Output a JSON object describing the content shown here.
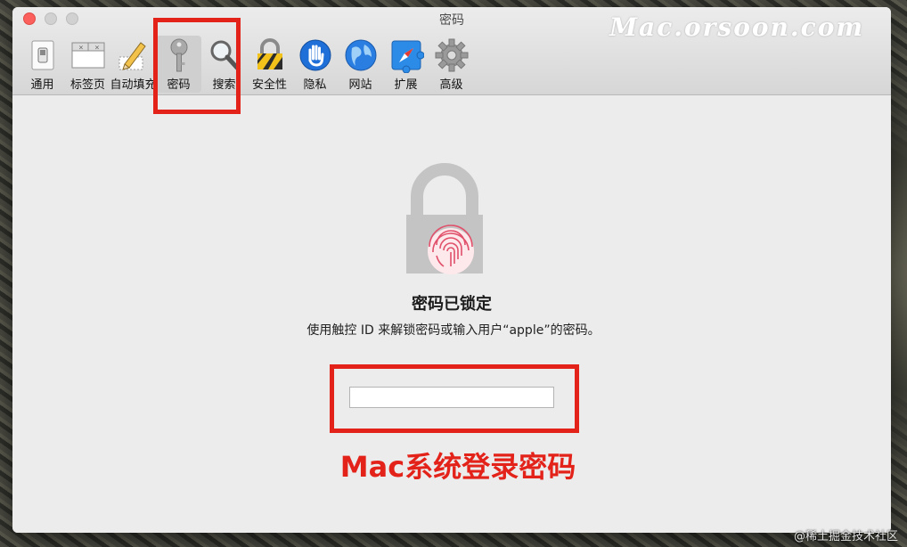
{
  "window": {
    "title": "密码",
    "watermark": "Mac.orsoon.com"
  },
  "toolbar": {
    "tabs": [
      {
        "label": "通用",
        "icon": "general-switch-icon"
      },
      {
        "label": "标签页",
        "icon": "tabs-window-icon"
      },
      {
        "label": "自动填充",
        "icon": "autofill-pencil-icon"
      },
      {
        "label": "密码",
        "icon": "key-icon",
        "active": true
      },
      {
        "label": "搜索",
        "icon": "magnifier-icon"
      },
      {
        "label": "安全性",
        "icon": "padlock-icon"
      },
      {
        "label": "隐私",
        "icon": "hand-icon"
      },
      {
        "label": "网站",
        "icon": "globe-icon"
      },
      {
        "label": "扩展",
        "icon": "puzzle-compass-icon"
      },
      {
        "label": "高级",
        "icon": "gear-icon"
      }
    ]
  },
  "main": {
    "heading": "密码已锁定",
    "description": "使用触控 ID 来解锁密码或输入用户“apple”的密码。",
    "password_field": {
      "value": "",
      "placeholder": ""
    },
    "annotation": "Mac系统登录密码"
  },
  "footer": {
    "credit": "@稀土掘金技术社区"
  },
  "colors": {
    "highlight": "#e3231a",
    "lock_gray": "#c4c4c4",
    "fingerprint": "#e0506a"
  }
}
